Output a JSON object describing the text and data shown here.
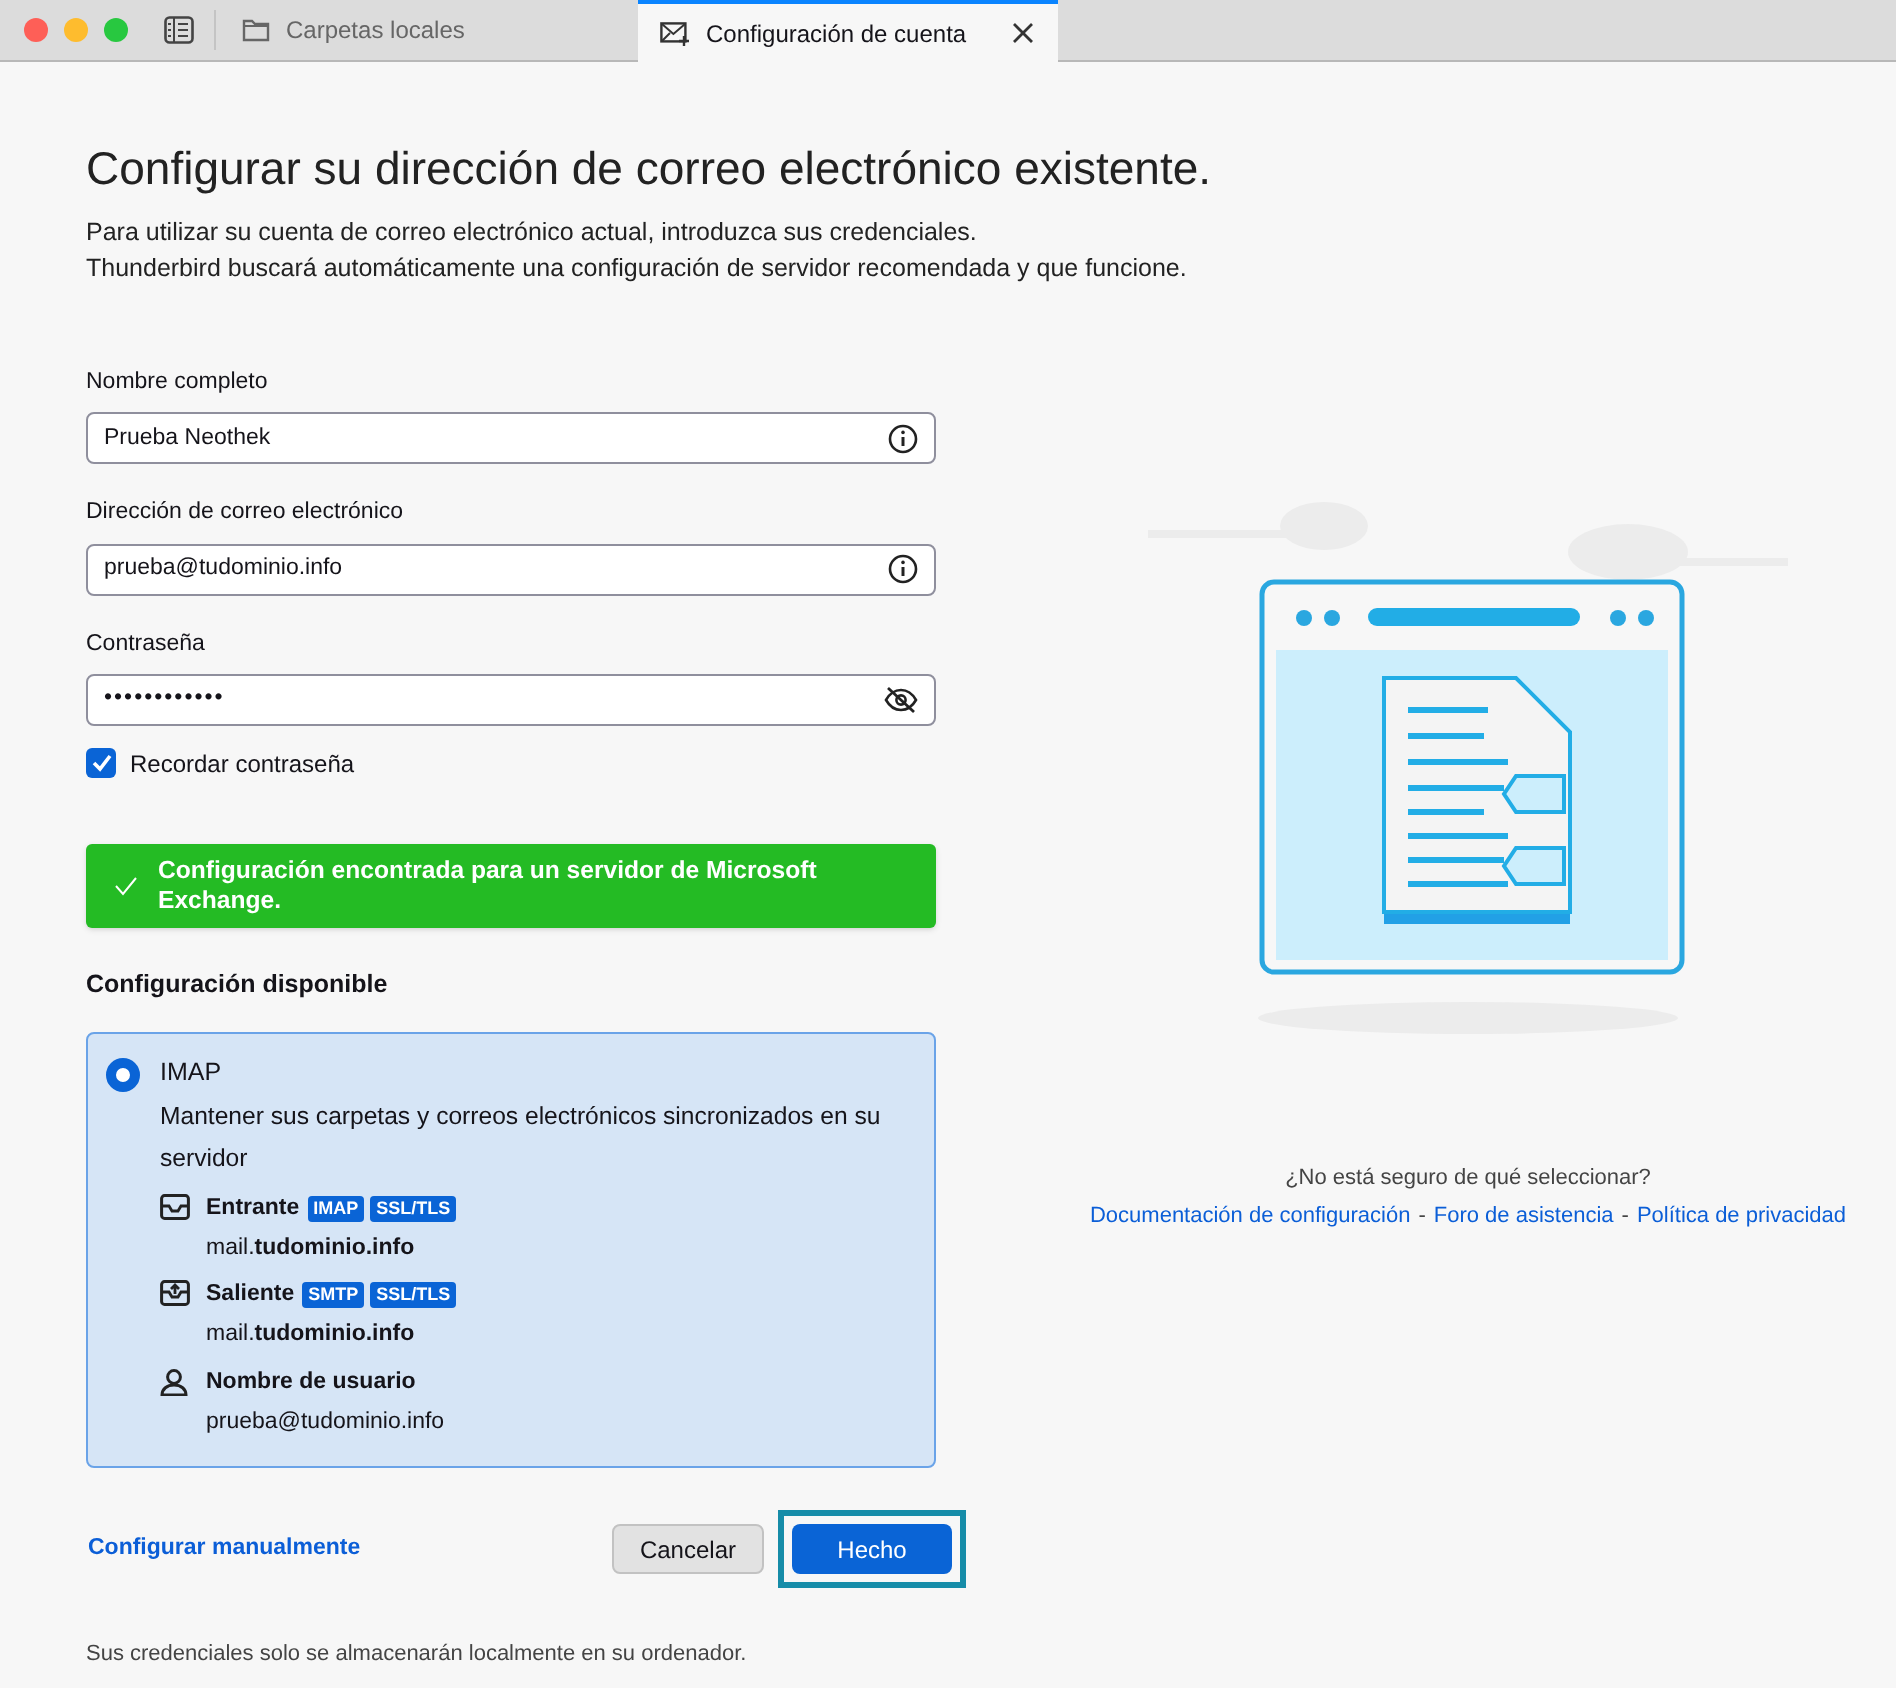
{
  "tabs": [
    {
      "label": "Carpetas locales",
      "selected": false,
      "kind": "folder"
    },
    {
      "label": "Configuración de cuenta",
      "selected": true,
      "kind": "account"
    }
  ],
  "heading": "Configurar su dirección de correo electrónico existente.",
  "intro": [
    "Para utilizar su cuenta de correo electrónico actual, introduzca sus credenciales.",
    "Thunderbird buscará automáticamente una configuración de servidor recomendada y que funcione."
  ],
  "fields": [
    {
      "label": "Nombre completo",
      "value": "Prueba Neothek",
      "kind": "info"
    },
    {
      "label": "Dirección de correo electrónico",
      "value": "prueba@tudominio.info",
      "kind": "info"
    },
    {
      "label": "Contraseña",
      "value": "••••••••••••",
      "kind": "password"
    }
  ],
  "remember": {
    "label": "Recordar contraseña",
    "checked": true
  },
  "notice": {
    "text": "Configuración encontrada para un servidor de Microsoft Exchange."
  },
  "section_title": "Configuración disponible",
  "options": [
    {
      "name": "IMAP",
      "selected": true,
      "description": "Mantener sus carpetas y correos electrónicos sincronizados en su servidor",
      "servers": [
        {
          "kind": "incoming",
          "label": "Entrante",
          "tags": [
            "IMAP",
            "SSL/TLS"
          ],
          "value": "mail.**tudominio.info**"
        },
        {
          "kind": "outgoing",
          "label": "Saliente",
          "tags": [
            "SMTP",
            "SSL/TLS"
          ],
          "value": "mail.**tudominio.info**"
        },
        {
          "kind": "user",
          "label": "Nombre de usuario",
          "value": "prueba@tudominio.info"
        }
      ]
    }
  ],
  "help": {
    "question": "¿No está seguro de qué seleccionar?",
    "links": [
      "Documentación de configuración",
      "Foro de asistencia",
      "Política de privacidad"
    ],
    "separator": "-"
  },
  "manual_link": "Configurar manualmente",
  "buttons": [
    {
      "label": "Cancelar",
      "kind": "secondary",
      "focused": false
    },
    {
      "label": "Hecho",
      "kind": "primary",
      "focused": true
    }
  ],
  "footer": "Sus credenciales solo se almacenarán localmente en su ordenador."
}
